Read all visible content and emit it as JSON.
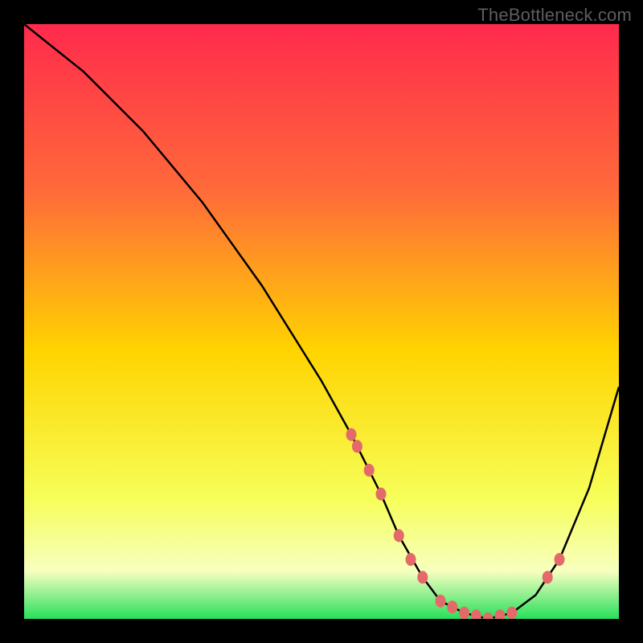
{
  "watermark": "TheBottleneck.com",
  "gradient": {
    "top": "#ff2a4c",
    "upper": "#ff6a3a",
    "mid": "#ffd400",
    "lower": "#f6ff5a",
    "pale": "#f7ffc0",
    "bottom": "#27e05b"
  },
  "curve_color": "#000000",
  "dot_color": "#e46a6a",
  "chart_data": {
    "type": "line",
    "title": "",
    "xlabel": "",
    "ylabel": "",
    "xlim": [
      0,
      100
    ],
    "ylim": [
      0,
      100
    ],
    "series": [
      {
        "name": "bottleneck-curve",
        "x": [
          0,
          5,
          10,
          15,
          20,
          25,
          30,
          35,
          40,
          45,
          50,
          55,
          60,
          63,
          67,
          70,
          74,
          78,
          82,
          86,
          90,
          95,
          100
        ],
        "values": [
          100,
          96,
          92,
          87,
          82,
          76,
          70,
          63,
          56,
          48,
          40,
          31,
          21,
          14,
          7,
          3,
          1,
          0,
          1,
          4,
          10,
          22,
          39
        ]
      }
    ],
    "markers": {
      "name": "highlight-dots",
      "x": [
        55,
        56,
        58,
        60,
        63,
        65,
        67,
        70,
        72,
        74,
        76,
        78,
        80,
        82,
        88,
        90
      ],
      "values": [
        31,
        29,
        25,
        21,
        14,
        10,
        7,
        3,
        2,
        1,
        0.5,
        0,
        0.5,
        1,
        7,
        10
      ]
    }
  }
}
